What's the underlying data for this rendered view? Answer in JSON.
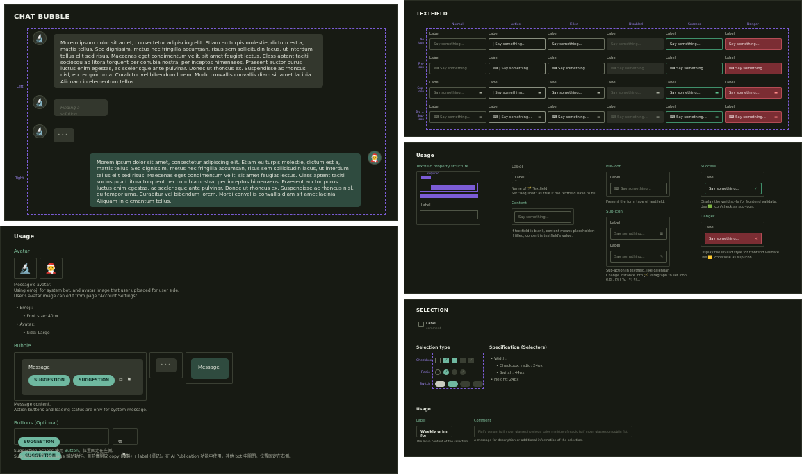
{
  "chat": {
    "title": "CHAT BUBBLE",
    "left_label": "Left",
    "right_label": "Right",
    "lorem": "Morem ipsum dolor sit amet, consectetur adipiscing elit. Etiam eu turpis molestie, dictum est a, mattis tellus. Sed dignissim, metus nec fringilla accumsan, risus sem sollicitudin lacus, ut interdum tellus elit sed risus. Maecenas eget condimentum velit, sit amet feugiat lectus. Class aptent taciti sociosqu ad litora torquent per conubia nostra, per inceptos himenaeos. Praesent auctor purus luctus enim egestas, ac scelerisque ante pulvinar. Donec ut rhoncus ex. Suspendisse ac rhoncus nisl, eu tempor urna. Curabitur vel bibendum lorem. Morbi convallis convallis diam sit amet lacinia. Aliquam in elementum tellus.",
    "finding": "Finding a solution...",
    "dots": "• • •"
  },
  "usage_left": {
    "title": "Usage",
    "avatar_h": "Avatar",
    "avatar_desc1": "Message's avatar.",
    "avatar_desc2": "Using emoji for system bot, and avatar image that user uploaded for user side.",
    "avatar_desc3": "User's avatar image can edit from page \"Account Settings\".",
    "emoji_h": "Emoji:",
    "emoji_font": "Font size: 40px",
    "avatar_item": "Avatar:",
    "avatar_size": "Size: Large",
    "bubble_h": "Bubble",
    "message": "Message",
    "suggestion": "SUGGESTION",
    "bubble_desc1": "Message content.",
    "bubble_desc2": "Action buttons and loading status are only for system message.",
    "buttons_h": "Buttons (Optional)",
    "btn_desc1a": "Suggestion actions 使用 ",
    "btn_desc1_link": "Button",
    "btn_desc1b": "。位置固定在左側。",
    "btn_desc2": "Sub-buttons 為 message 輔助動作。目前僅開放 copy (複製) + label (標記)。在 AI Publication 功能中使用，其他 bot 中關閉。位置固定在右側。"
  },
  "textfield": {
    "title": "TEXTFIELD",
    "columns": [
      "Normal",
      "Active",
      "Filled",
      "Disabled",
      "Success",
      "Danger"
    ],
    "rows": [
      "No icon",
      "Pre-icon",
      "Sup-icon",
      "Pre + Sup-icon"
    ],
    "label": "Label",
    "placeholder": "Say something...",
    "active_text": "Say something...",
    "filled_text": "Say something..."
  },
  "tf_usage": {
    "title": "Usage",
    "structure_h": "Textfield property structure",
    "required": "Required",
    "label_small": "Label",
    "content_small": "Content",
    "message_small": "Message",
    "label_h": "Label",
    "label_star": "Label *",
    "label_desc1": "Name of 🪄 Textfield.",
    "label_desc2": "Set \"Required\" as true if the textfield have to fill.",
    "content_h": "Content",
    "content_ph": "Say something...",
    "content_desc1": "If textfield is blank, content means placeholder;",
    "content_desc2": "If filled, content is textfield's value.",
    "preicon_h": "Pre-icon",
    "preicon_desc": "Present the form type of textfield.",
    "supicon_h": "Sup-icon",
    "supicon_desc1": "Sub-action in textfield, like calendar.",
    "supicon_desc2": "Change instance into 🪄 Paragraph to set icon.",
    "supicon_desc3": "e.g., (%) %, (¥) ¥/...",
    "success_h": "Success",
    "success_desc1": "Display the valid style for frontend validate.",
    "success_desc2": "Use 🟩 Icon/check as sup-icon.",
    "danger_h": "Danger",
    "danger_desc1": "Display the invalid style for frontend validate.",
    "danger_desc2": "Use 🟨 Icon/close as sup-icon."
  },
  "selection": {
    "title": "SELECTION",
    "label": "Label",
    "comment": "comment",
    "type_h": "Selection type",
    "checkbox": "Checkbox",
    "radio": "Radio",
    "switch": "Switch",
    "spec_h": "Specification (Selectors)",
    "width": "Width:",
    "width1": "Checkbox, radio: 24px",
    "width2": "Switch: 44px",
    "height": "Height: 24px",
    "usage_h": "Usage",
    "label_h": "Label",
    "comment_h": "Comment",
    "label_ex": "Weekly grim for",
    "comment_ex": "Fluffy venom half moon glasses holyhead sales ministry of magic half moon glasses on goblin fist.",
    "label_desc": "The main content of the selection.",
    "comment_desc": "A message for description or additional information of the selection."
  },
  "colors": {
    "bg": "#171a13",
    "accent": "#7b5cd6",
    "success": "#3f8f6a",
    "danger": "#7b2d33",
    "pill": "#6fb8a0"
  }
}
